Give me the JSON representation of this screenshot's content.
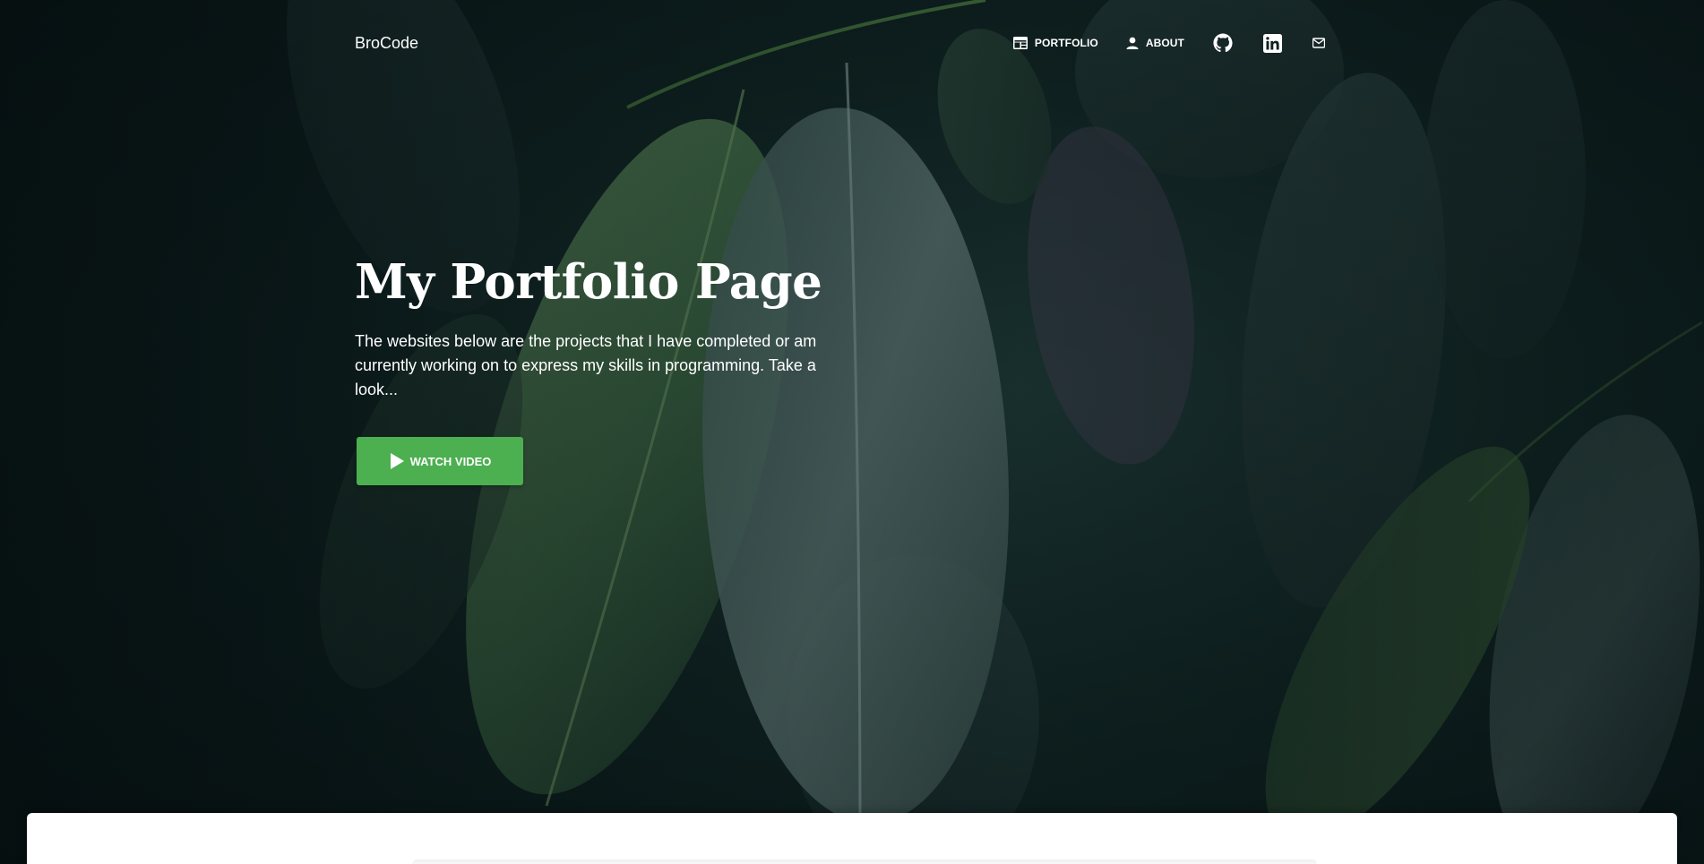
{
  "brand": {
    "name": "BroCode"
  },
  "nav": {
    "portfolio_label": "PORTFOLIO",
    "about_label": "ABOUT",
    "icons": [
      "dashboard-icon",
      "person-icon",
      "github-icon",
      "linkedin-icon",
      "mail-icon"
    ]
  },
  "hero": {
    "title": "My Portfolio Page",
    "description": "The websites below are the projects that I have completed or am currently working on to express my skills in programming. Take a look...",
    "button_label": "WATCH VIDEO",
    "button_icon": "play-icon",
    "background": "dark-green-leaves-photo"
  },
  "colors": {
    "accent": "#4caf50",
    "background_dark": "#0d1a1c",
    "text": "#ffffff",
    "card": "#ffffff"
  }
}
